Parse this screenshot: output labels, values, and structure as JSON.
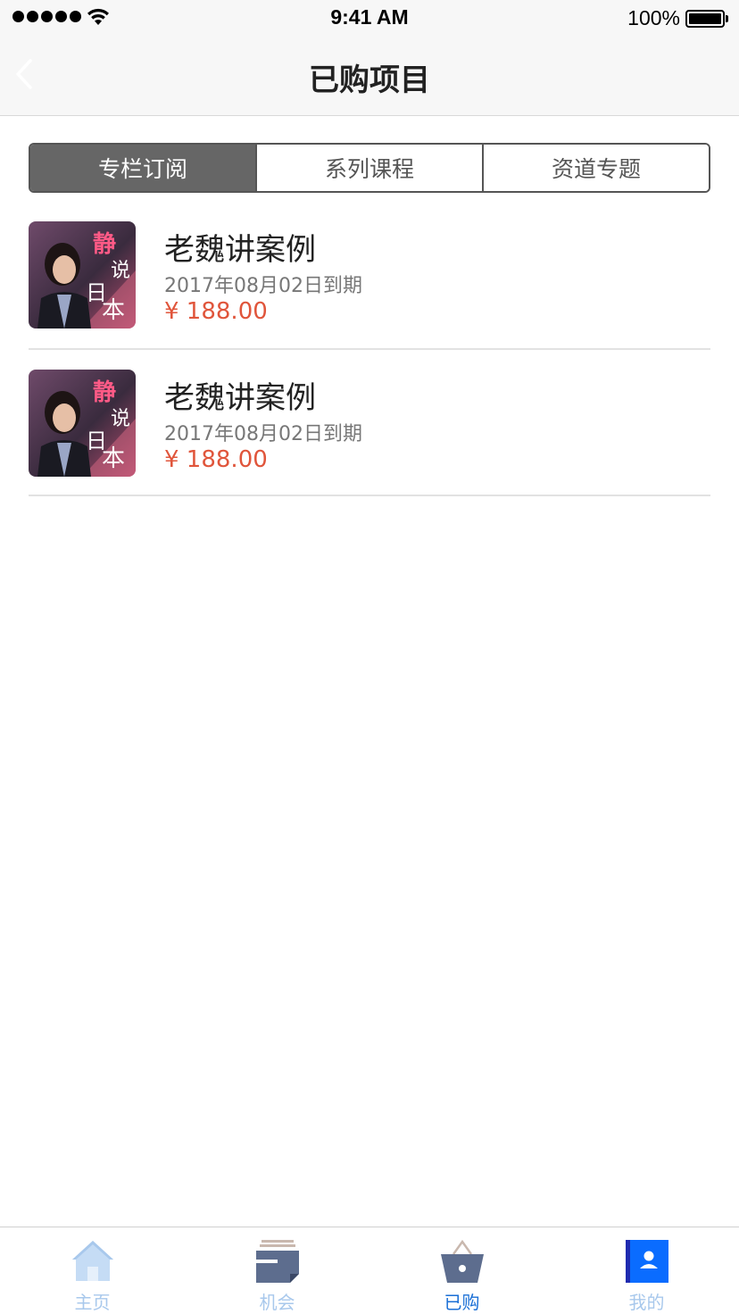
{
  "status_bar": {
    "time": "9:41 AM",
    "battery": "100%"
  },
  "nav": {
    "title": "已购项目"
  },
  "segments": [
    {
      "label": "专栏订阅",
      "active": true
    },
    {
      "label": "系列课程",
      "active": false
    },
    {
      "label": "资道专题",
      "active": false
    }
  ],
  "items": [
    {
      "title": "老魏讲案例",
      "expiry": "2017年08月02日到期",
      "price": "¥ 188.00",
      "thumb_text": "静说日本"
    },
    {
      "title": "老魏讲案例",
      "expiry": "2017年08月02日到期",
      "price": "¥ 188.00",
      "thumb_text": "静说日本"
    }
  ],
  "tabs": [
    {
      "label": "主页",
      "icon": "home-icon",
      "color": "#a8c8ec"
    },
    {
      "label": "机会",
      "icon": "folder-icon",
      "color": "#a8c8ec"
    },
    {
      "label": "已购",
      "icon": "basket-icon",
      "color": "#1a6fd6"
    },
    {
      "label": "我的",
      "icon": "user-icon",
      "color": "#a8c8ec"
    }
  ],
  "colors": {
    "accent": "#1a6fd6",
    "price": "#e0553b",
    "segment_active": "#666666"
  }
}
